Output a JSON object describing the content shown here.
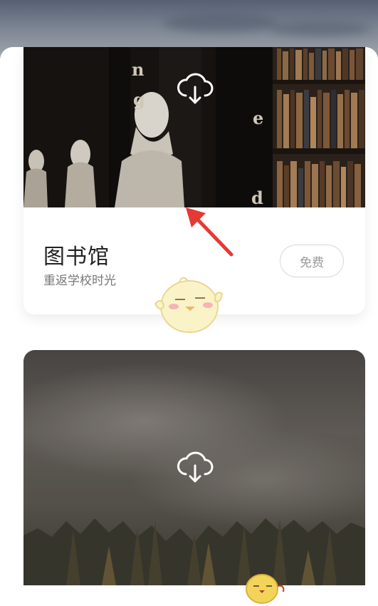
{
  "cards": [
    {
      "title": "图书馆",
      "subtitle": "重返学校时光",
      "price": "免费",
      "cover_letters": [
        "n",
        "g",
        "e",
        "d"
      ],
      "accent": "#e53935"
    },
    {
      "title": "",
      "subtitle": "",
      "price": ""
    }
  ],
  "icons": {
    "download": "cloud-download-icon"
  }
}
